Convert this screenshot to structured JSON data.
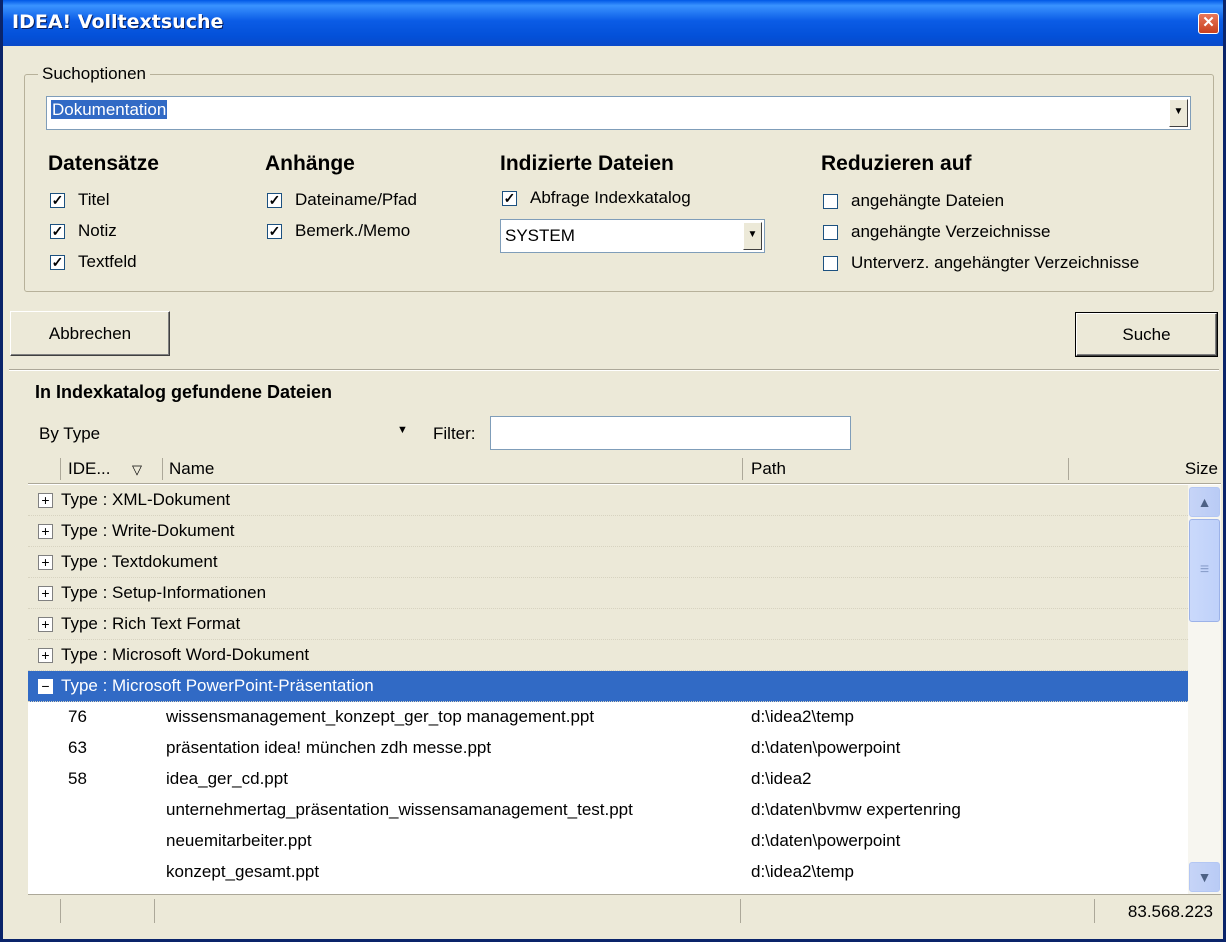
{
  "window": {
    "title": "IDEA! Volltextsuche",
    "close_glyph": "✕"
  },
  "search": {
    "group_label": "Suchoptionen",
    "query": "Dokumentation",
    "columns": {
      "datensaetze": {
        "heading": "Datensätze",
        "items": [
          {
            "label": "Titel",
            "checked": true
          },
          {
            "label": "Notiz",
            "checked": true
          },
          {
            "label": "Textfeld",
            "checked": true
          }
        ]
      },
      "anhaenge": {
        "heading": "Anhänge",
        "items": [
          {
            "label": "Dateiname/Pfad",
            "checked": true
          },
          {
            "label": "Bemerk./Memo",
            "checked": true
          }
        ]
      },
      "indiziert": {
        "heading": "Indizierte Dateien",
        "items": [
          {
            "label": "Abfrage Indexkatalog",
            "checked": true
          }
        ],
        "catalog": "SYSTEM"
      },
      "reduzieren": {
        "heading": "Reduzieren auf",
        "items": [
          {
            "label": "angehängte Dateien",
            "checked": false
          },
          {
            "label": "angehängte Verzeichnisse",
            "checked": false
          },
          {
            "label": "Unterverz. angehängter Verzeichnisse",
            "checked": false
          }
        ]
      }
    }
  },
  "buttons": {
    "cancel": "Abbrechen",
    "search": "Suche"
  },
  "results": {
    "title": "In Indexkatalog gefundene Dateien",
    "group_by": "By Type",
    "filter_label": "Filter:",
    "filter_value": "",
    "headers": {
      "id": "IDE...",
      "sort_glyph": "▽",
      "name": "Name",
      "path": "Path",
      "size": "Size"
    },
    "groups": [
      {
        "label": "Type : XML-Dokument",
        "expanded": false,
        "selected": false
      },
      {
        "label": "Type : Write-Dokument",
        "expanded": false,
        "selected": false
      },
      {
        "label": "Type : Textdokument",
        "expanded": false,
        "selected": false
      },
      {
        "label": "Type : Setup-Informationen",
        "expanded": false,
        "selected": false
      },
      {
        "label": "Type : Rich Text Format",
        "expanded": false,
        "selected": false
      },
      {
        "label": "Type : Microsoft Word-Dokument",
        "expanded": false,
        "selected": false
      },
      {
        "label": "Type : Microsoft PowerPoint-Präsentation",
        "expanded": true,
        "selected": true
      }
    ],
    "rows": [
      {
        "id": "76",
        "name": "wissensmanagement_konzept_ger_top management.ppt",
        "path": "d:\\idea2\\temp"
      },
      {
        "id": "63",
        "name": "präsentation idea! münchen zdh messe.ppt",
        "path": "d:\\daten\\powerpoint"
      },
      {
        "id": "58",
        "name": "idea_ger_cd.ppt",
        "path": "d:\\idea2"
      },
      {
        "id": "",
        "name": "unternehmertag_präsentation_wissensamanagement_test.ppt",
        "path": "d:\\daten\\bvmw expertenring"
      },
      {
        "id": "",
        "name": "neuemitarbeiter.ppt",
        "path": "d:\\daten\\powerpoint"
      },
      {
        "id": "",
        "name": "konzept_gesamt.ppt",
        "path": "d:\\idea2\\temp"
      }
    ],
    "total_size": "83.568.223"
  }
}
